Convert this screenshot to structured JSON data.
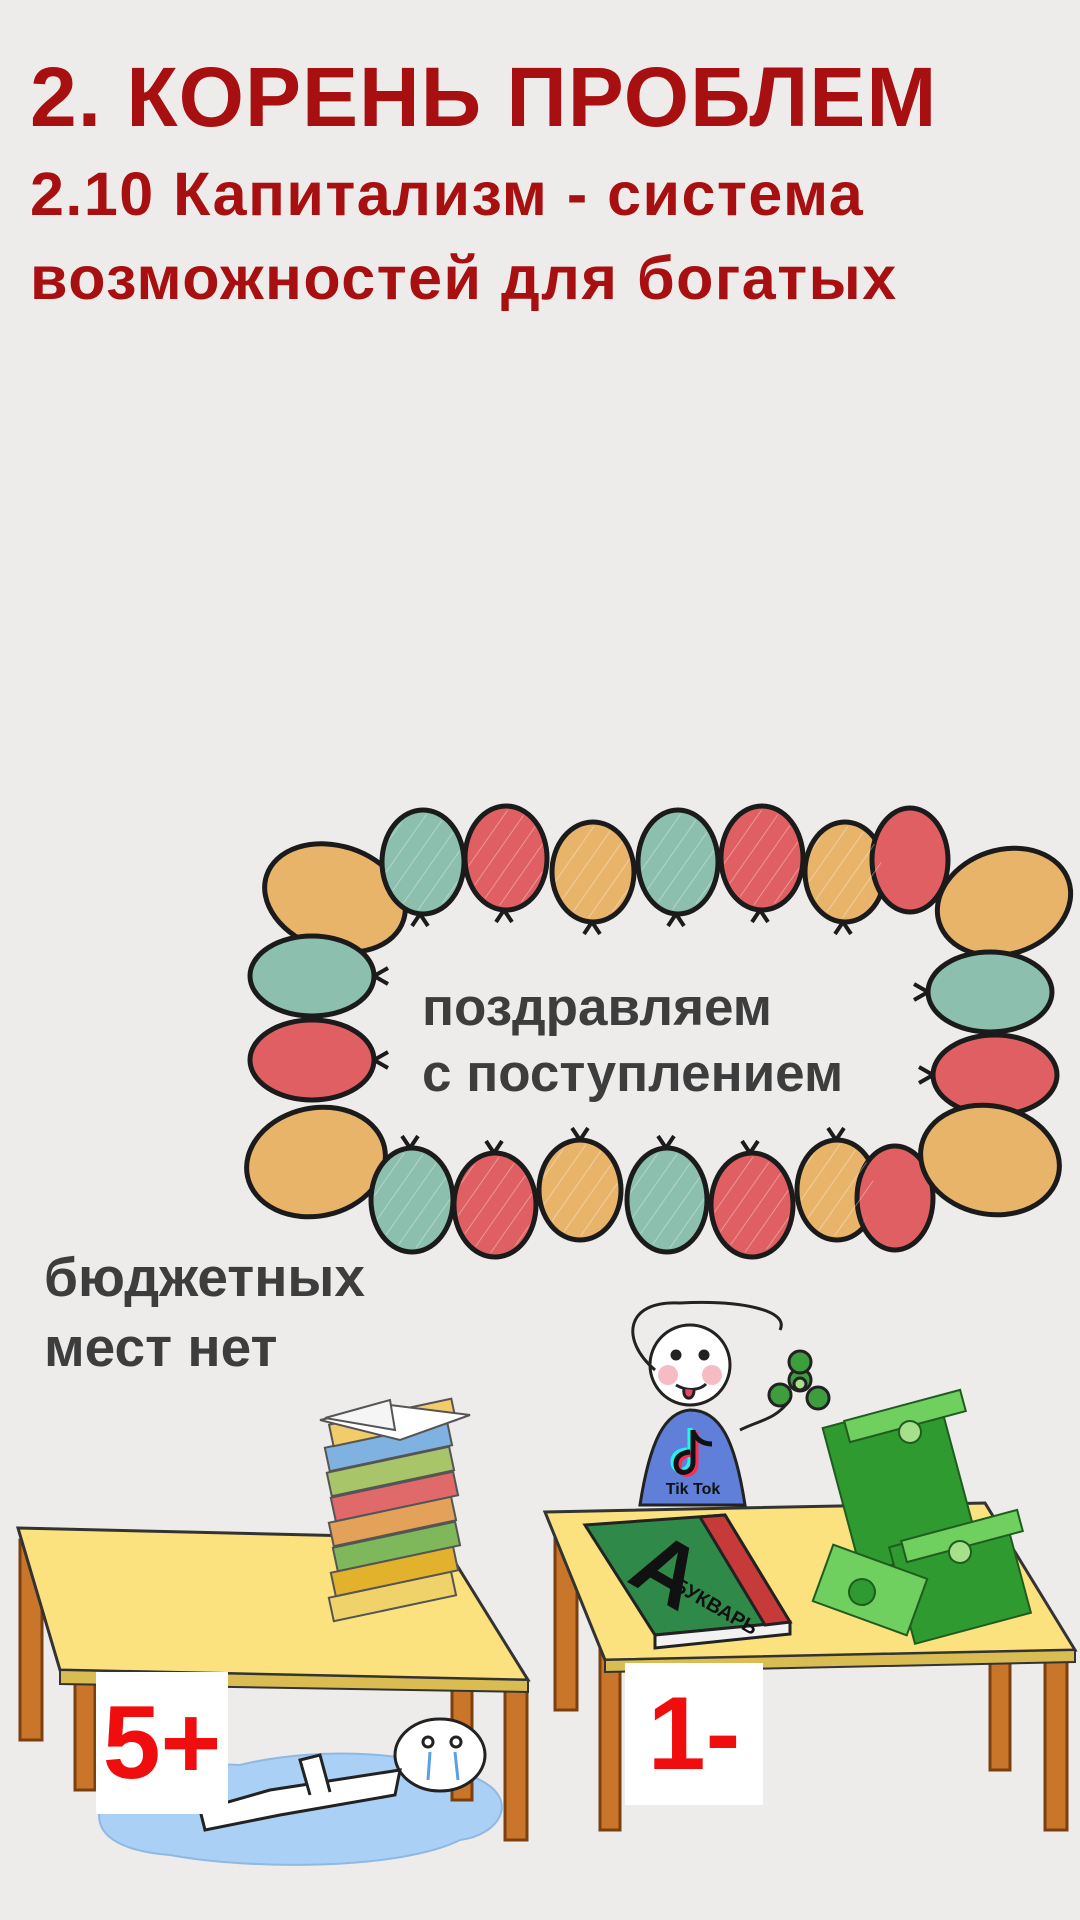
{
  "header": {
    "title": "2. КОРЕНЬ ПРОБЛЕМ",
    "subtitle_line1": "2.10 Капитализм - система",
    "subtitle_line2": "возможностей для богатых"
  },
  "banner": {
    "line1": "поздравляем",
    "line2": "с поступлением"
  },
  "no_places": {
    "line1": "бюджетных",
    "line2": "мест нет"
  },
  "left_desk": {
    "grade": "5+"
  },
  "right_desk": {
    "grade": "1-",
    "shirt_logo": "Tik Tok",
    "book_title": "БУКВАРЬ",
    "book_letter": "А"
  },
  "colors": {
    "title": "#a80f10",
    "balloon_orange": "#e8b46a",
    "balloon_teal": "#8cbfae",
    "balloon_red": "#df5f62",
    "desk_top": "#fbe27f",
    "desk_leg": "#c9762a",
    "puddle": "#aad0f5",
    "money": "#2f9a2f",
    "grade_text": "#f00d0d"
  }
}
